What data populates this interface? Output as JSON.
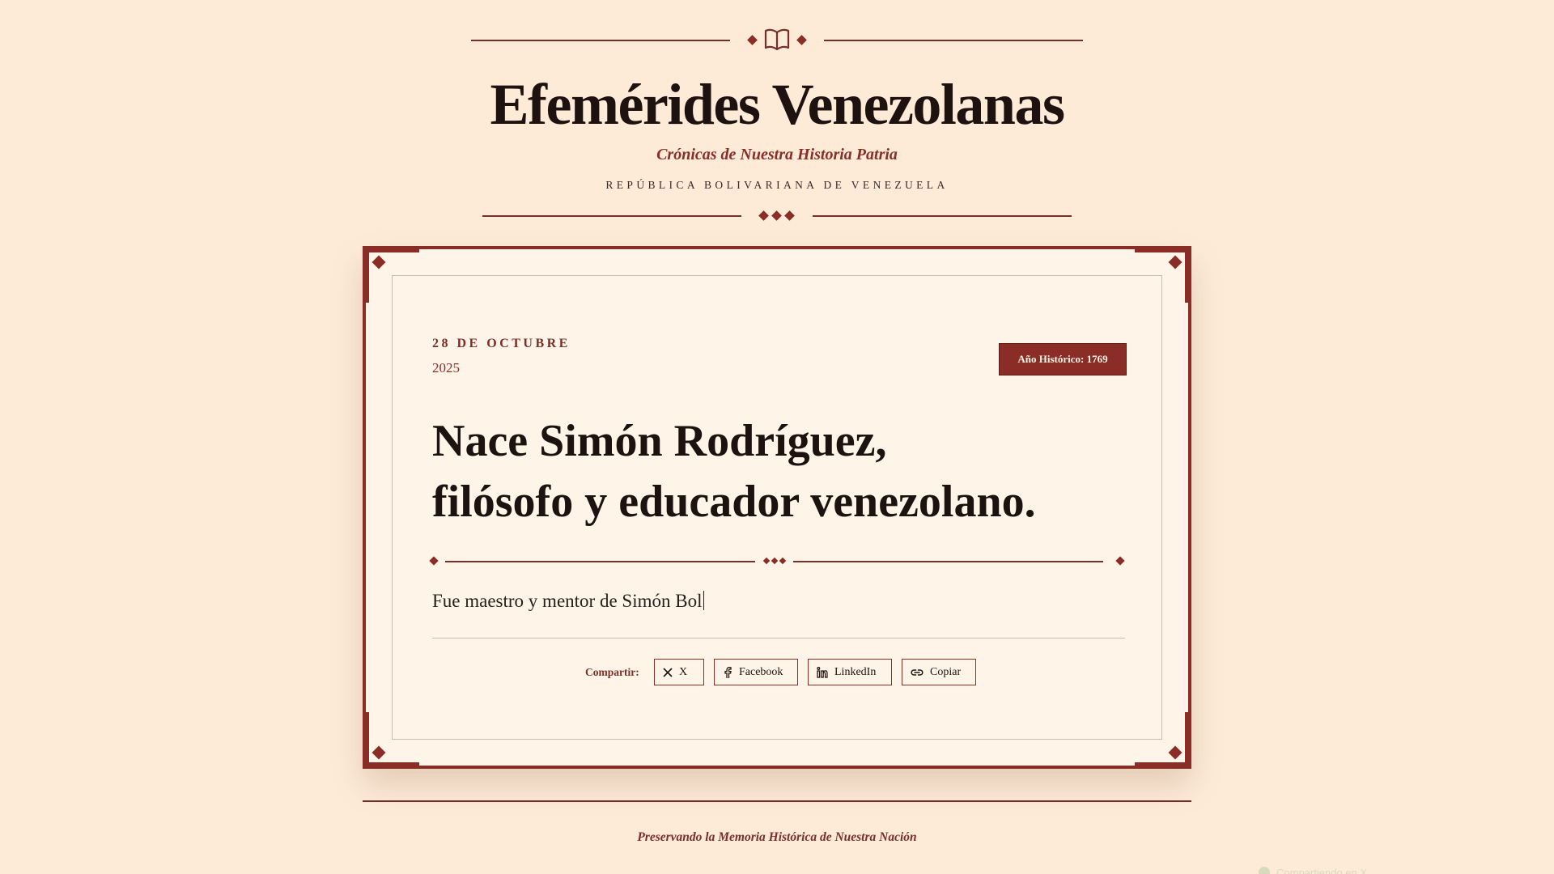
{
  "header": {
    "title": "Efemérides Venezolanas",
    "subtitle": "Crónicas de Nuestra Historia Patria",
    "country": "REPÚBLICA BOLIVARIANA DE VENEZUELA"
  },
  "card": {
    "date_label": "28 DE OCTUBRE",
    "year": "2025",
    "historic_year_badge": "Año Histórico: 1769",
    "headline_line1": "Nace Simón Rodríguez,",
    "headline_line2": "filósofo y educador venezolano.",
    "excerpt": "Fue maestro y mentor de Simón Bol"
  },
  "share": {
    "label": "Compartir:",
    "buttons": [
      {
        "label": "X",
        "icon": "x-icon"
      },
      {
        "label": "Facebook",
        "icon": "facebook-icon"
      },
      {
        "label": "LinkedIn",
        "icon": "linkedin-icon"
      },
      {
        "label": "Copiar",
        "icon": "link-icon"
      }
    ]
  },
  "footer": {
    "text": "Preservando la Memoria Histórica de Nuestra Nación"
  },
  "toast": {
    "text": "Compartiendo en X"
  },
  "colors": {
    "background": "#fdebd8",
    "accent": "#8b2d27",
    "card": "#fff4e8",
    "text": "#1e1210"
  }
}
